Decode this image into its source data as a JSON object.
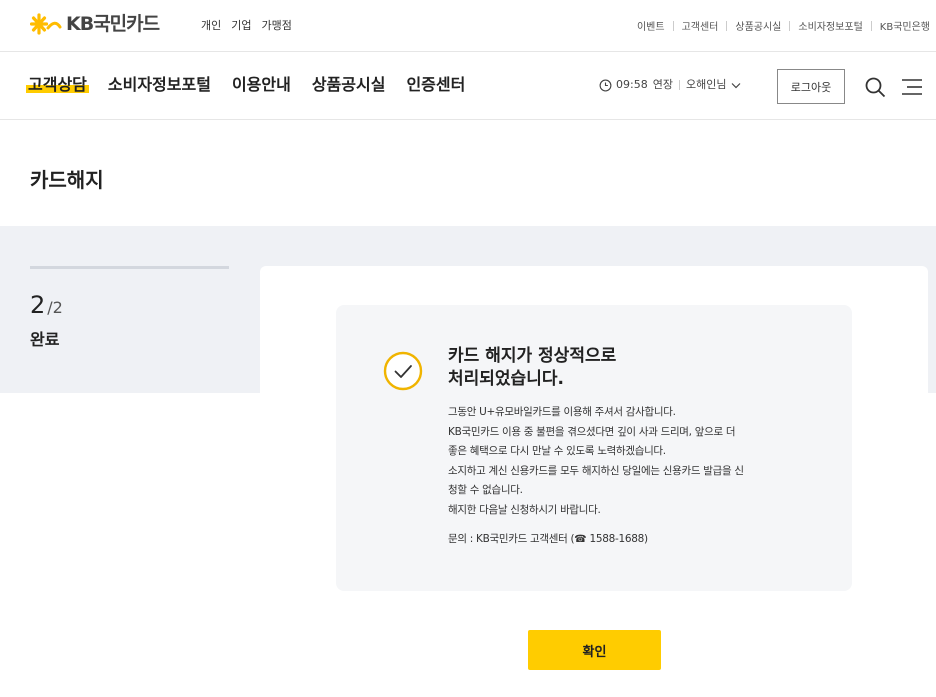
{
  "brand": {
    "name": "KB국민카드",
    "accent": "#ffcc00",
    "logo_icon": "kb-star-logo-icon"
  },
  "topbar": {
    "segments": [
      "개인",
      "기업",
      "가맹점"
    ],
    "utility_links": [
      "이벤트",
      "고객센터",
      "상품공시실",
      "소비자정보포털",
      "KB국민은행"
    ]
  },
  "gnb": {
    "menu": [
      "고객상담",
      "소비자정보포털",
      "이용안내",
      "상품공시실",
      "인증센터"
    ],
    "active_index": 0,
    "session_time": "09:58",
    "extend_label": "연장",
    "user_name": "오해인님",
    "logout_label": "로그아웃",
    "icons": [
      "clock-icon",
      "chevron-down-icon",
      "search-icon",
      "menu-icon"
    ]
  },
  "page": {
    "title": "카드해지"
  },
  "progress": {
    "current": "2",
    "total": "/2",
    "label": "완료"
  },
  "result": {
    "icon": "check-circle-icon",
    "title_line1": "카드 해지가 정상적으로",
    "title_line2": "처리되었습니다.",
    "body_lines": [
      "그동안 U+유모바일카드를 이용해 주셔서 감사합니다.",
      "KB국민카드 이용 중 불편을 겪으셨다면 깊이 사과 드리며, 앞으로 더",
      "좋은 혜택으로 다시 만날 수 있도록 노력하겠습니다.",
      "소지하고 계신 신용카드를 모두 해지하신 당일에는 신용카드 발급을 신",
      "청할 수 없습니다.",
      "해지한 다음날 신청하시기 바랍니다."
    ],
    "contact_prefix": "문의 : KB국민카드 고객센터 (",
    "contact_phone_icon": "phone-icon",
    "contact_number": "1588-1688",
    "contact_suffix": ")"
  },
  "confirm_label": "확인"
}
